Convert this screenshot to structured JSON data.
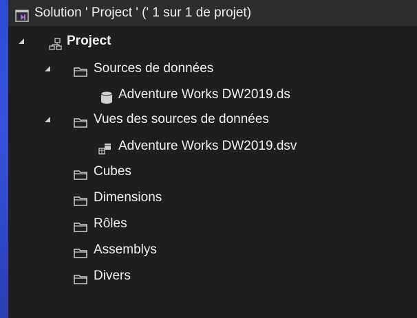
{
  "explorer": {
    "solution_label": "Solution ' Project ' (' 1 sur 1 de projet)",
    "project_label": "Project",
    "folders": {
      "datasources": "Sources de données",
      "datasource_item": "Adventure Works DW2019.ds",
      "dsv": "Vues des sources de données",
      "dsv_item": "Adventure Works DW2019.dsv",
      "cubes": "Cubes",
      "dimensions": "Dimensions",
      "roles": "Rôles",
      "assemblies": "Assemblys",
      "misc": "Divers"
    }
  },
  "colors": {
    "panel_bg": "#1e1e1e",
    "solution_icon_accent": "#a26ad9",
    "text": "#f1f1f1"
  },
  "icons": {
    "solution": "visual-studio-solution-icon",
    "project": "project-hierarchy-icon",
    "folder": "folder-icon",
    "datasource": "database-cylinder-icon",
    "dsv": "data-source-view-icon",
    "expanded": "caret-expanded-icon"
  }
}
